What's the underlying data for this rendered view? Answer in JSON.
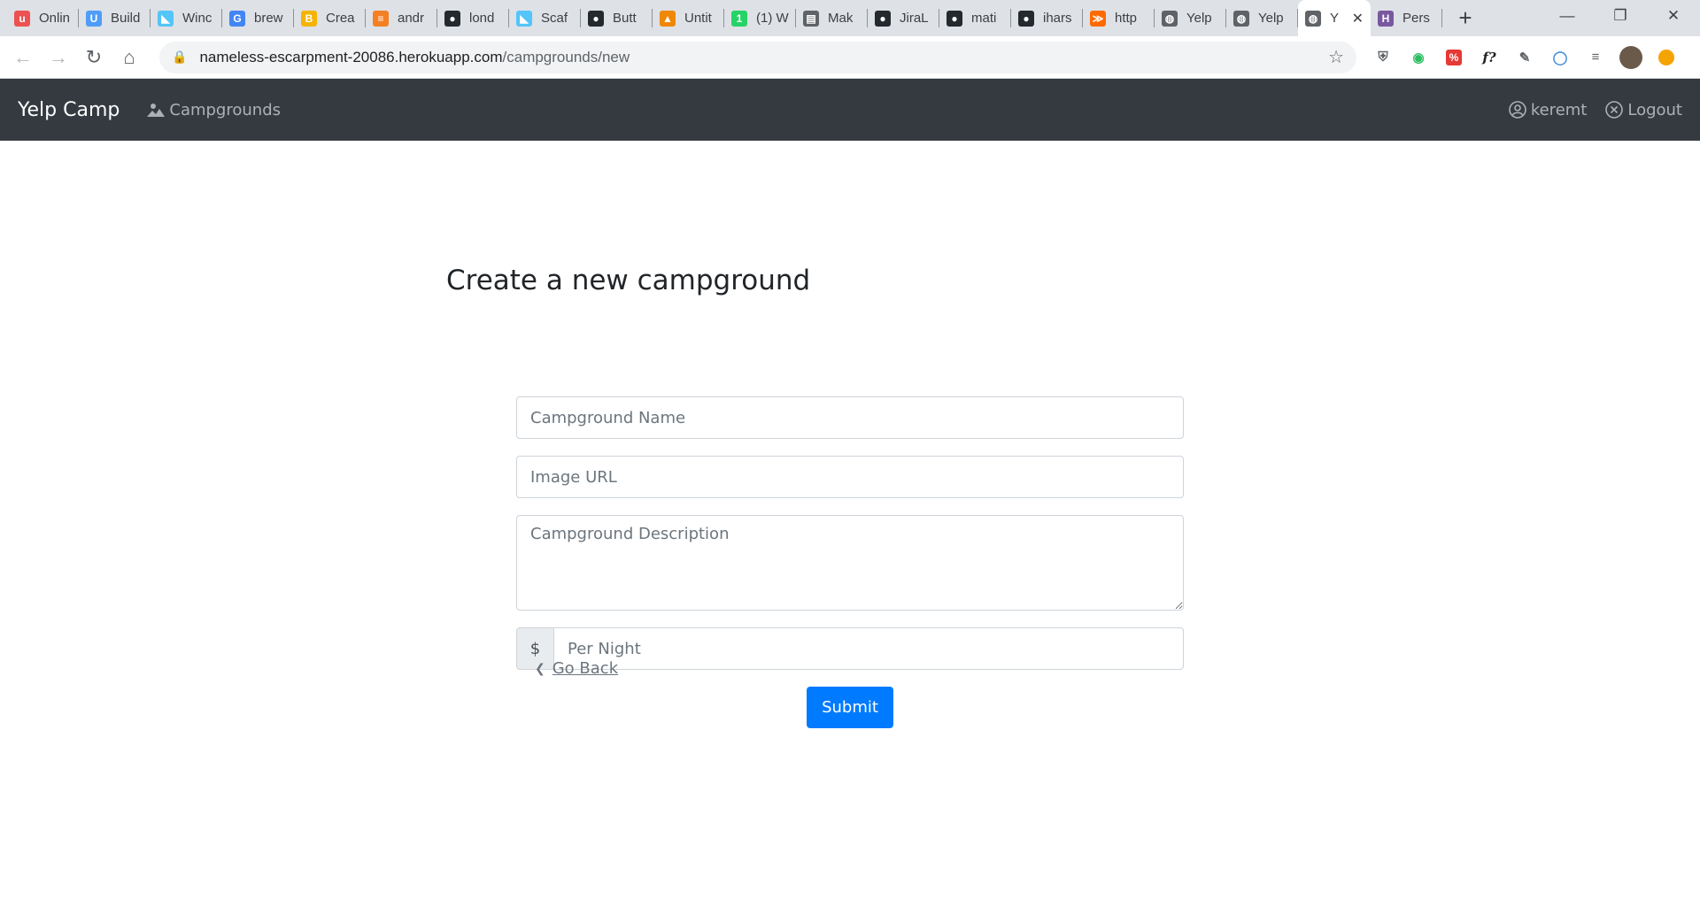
{
  "browser": {
    "tabs": [
      {
        "label": "Onlin",
        "icon": "udemy-icon",
        "color": "#ec5252",
        "glyph": "u"
      },
      {
        "label": "Build",
        "icon": "webflow-icon",
        "color": "#4f9cf9",
        "glyph": "U"
      },
      {
        "label": "Winc",
        "icon": "flutter-icon",
        "color": "#54c5f8",
        "glyph": "◣"
      },
      {
        "label": "brew",
        "icon": "google-icon",
        "color": "#4285f4",
        "glyph": "G"
      },
      {
        "label": "Crea",
        "icon": "beer-icon",
        "color": "#f5b400",
        "glyph": "B"
      },
      {
        "label": "andr",
        "icon": "stackoverflow-icon",
        "color": "#f48024",
        "glyph": "≡"
      },
      {
        "label": "lond",
        "icon": "github-icon",
        "color": "#24292e",
        "glyph": "●"
      },
      {
        "label": "Scaf",
        "icon": "flutter-icon",
        "color": "#54c5f8",
        "glyph": "◣"
      },
      {
        "label": "Butt",
        "icon": "github-icon",
        "color": "#24292e",
        "glyph": "●"
      },
      {
        "label": "Untit",
        "icon": "drawio-icon",
        "color": "#f08705",
        "glyph": "▲"
      },
      {
        "label": "(1) W",
        "icon": "whatsapp-icon",
        "color": "#25d366",
        "glyph": "1"
      },
      {
        "label": "Mak",
        "icon": "document-icon",
        "color": "#5f6368",
        "glyph": "▤"
      },
      {
        "label": "JiraL",
        "icon": "github-icon",
        "color": "#24292e",
        "glyph": "●"
      },
      {
        "label": "mati",
        "icon": "github-icon",
        "color": "#24292e",
        "glyph": "●"
      },
      {
        "label": "ihars",
        "icon": "github-icon",
        "color": "#24292e",
        "glyph": "●"
      },
      {
        "label": "http",
        "icon": "bolt-icon",
        "color": "#ff6a00",
        "glyph": "≫"
      },
      {
        "label": "Yelp",
        "icon": "globe-icon",
        "color": "#5f6368",
        "glyph": "◍"
      },
      {
        "label": "Yelp",
        "icon": "globe-icon",
        "color": "#5f6368",
        "glyph": "◍"
      },
      {
        "label": "Y",
        "icon": "globe-icon",
        "color": "#5f6368",
        "glyph": "◍",
        "active": true
      },
      {
        "label": "Pers",
        "icon": "heroku-icon",
        "color": "#79589f",
        "glyph": "H"
      }
    ],
    "url_host": "nameless-escarpment-20086.herokuapp.com",
    "url_path": "/campgrounds/new"
  },
  "navbar": {
    "brand": "Yelp Camp",
    "campgrounds_label": "Campgrounds",
    "user_label": "keremt",
    "logout_label": "Logout"
  },
  "page": {
    "title": "Create a new campground"
  },
  "form": {
    "name_placeholder": "Campground Name",
    "image_placeholder": "Image URL",
    "description_placeholder": "Campground Description",
    "currency_symbol": "$",
    "price_placeholder": "Per Night",
    "submit_label": "Submit"
  },
  "footer": {
    "go_back_label": "Go Back"
  }
}
